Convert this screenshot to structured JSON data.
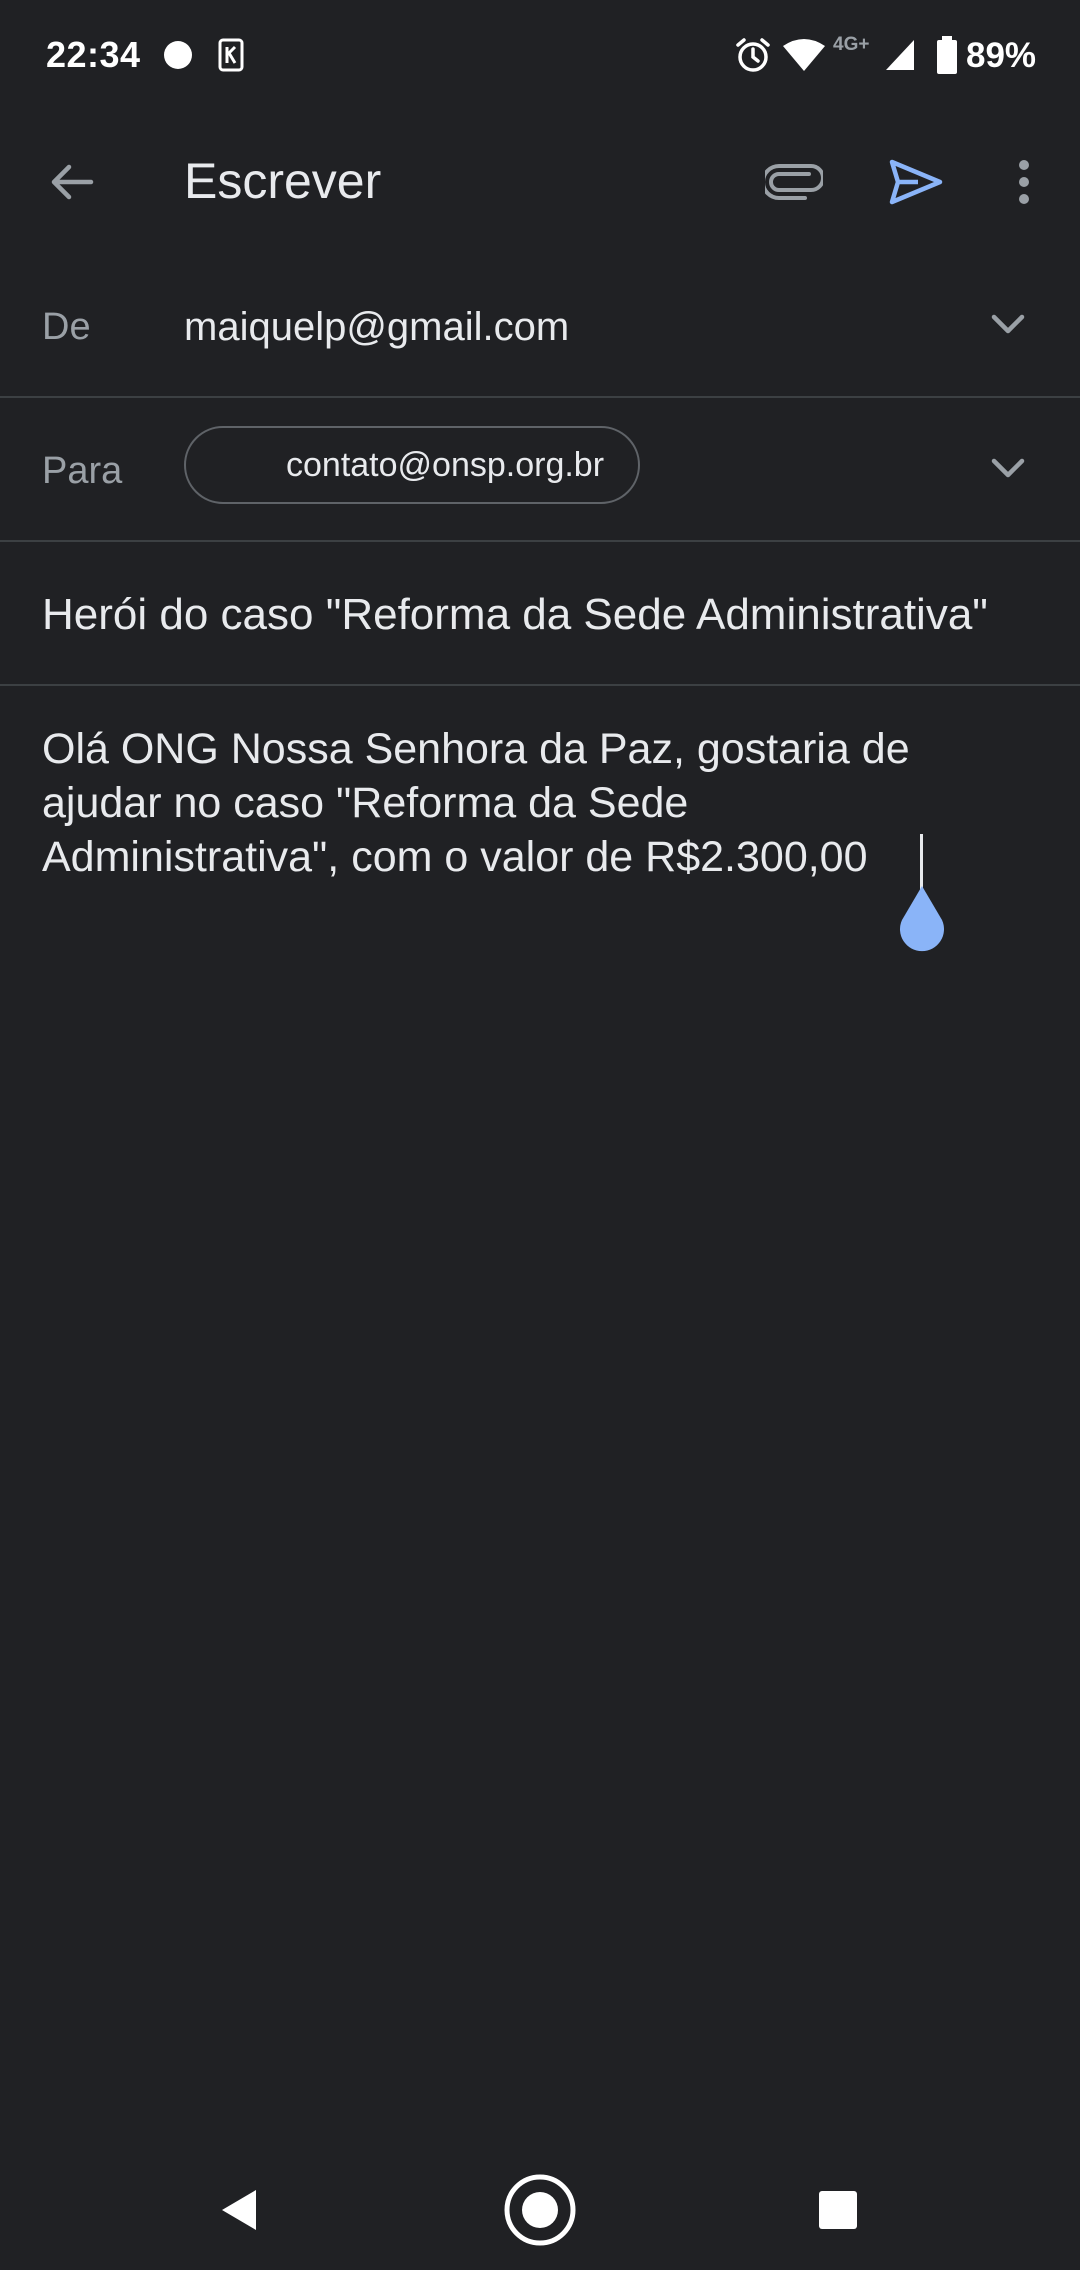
{
  "status_bar": {
    "time": "22:34",
    "network_label": "4G+",
    "battery_percent": "89%",
    "icons": [
      "notification-dot-icon",
      "k-app-icon",
      "alarm-icon",
      "wifi-icon",
      "signal-icon",
      "battery-icon"
    ]
  },
  "toolbar": {
    "title": "Escrever",
    "icons": [
      "back-arrow-icon",
      "attach-icon",
      "send-icon",
      "more-vert-icon"
    ],
    "send_color": "#8ab4f8"
  },
  "compose": {
    "from_label": "De",
    "from_value": "maiquelp@gmail.com",
    "to_label": "Para",
    "to_chip": "contato@onsp.org.br",
    "subject": "Herói do caso \"Reforma da Sede Administrativa\"",
    "body_lines": [
      "Olá ONG Nossa Senhora da Paz, gostaria de",
      "ajudar no caso \"Reforma da Sede",
      "Administrativa\", com o valor de R$2.300,00"
    ]
  },
  "nav_bar": {
    "icons": [
      "back-triangle-icon",
      "home-circle-icon",
      "recents-square-icon"
    ]
  },
  "colors": {
    "background": "#202124",
    "text": "#e8eaed",
    "muted": "#9aa0a6",
    "divider": "#3c4043",
    "accent": "#8ab4f8"
  }
}
